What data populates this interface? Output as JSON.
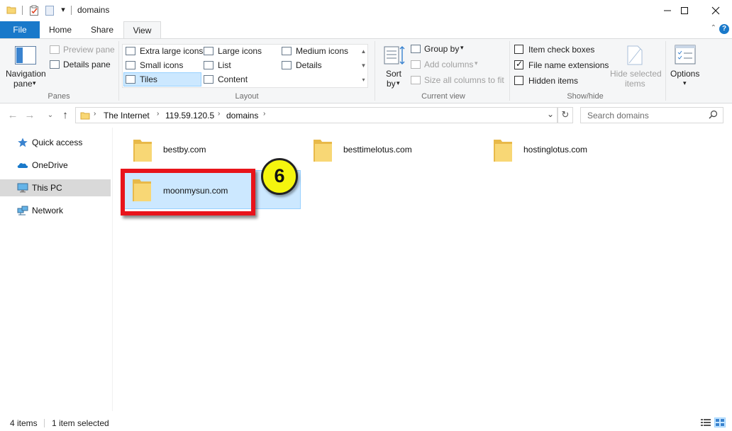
{
  "window": {
    "title": "domains",
    "minimize_glyph": "—",
    "maximize_glyph": "☐",
    "close_glyph": "✕"
  },
  "tabs": [
    {
      "label": "File",
      "active": false
    },
    {
      "label": "Home",
      "active": false
    },
    {
      "label": "Share",
      "active": false
    },
    {
      "label": "View",
      "active": true
    }
  ],
  "ribbon": {
    "panes": {
      "group_label": "Panes",
      "navigation_pane_line1": "Navigation",
      "navigation_pane_line2": "pane",
      "preview_pane": "Preview pane",
      "details_pane": "Details pane"
    },
    "layout": {
      "group_label": "Layout",
      "extra_large_icons": "Extra large icons",
      "large_icons": "Large icons",
      "medium_icons": "Medium icons",
      "small_icons": "Small icons",
      "list": "List",
      "details": "Details",
      "tiles": "Tiles",
      "content": "Content",
      "selected": "Tiles"
    },
    "current_view": {
      "group_label": "Current view",
      "sort_line1": "Sort",
      "sort_line2": "by",
      "group_by": "Group by",
      "add_columns": "Add columns",
      "size_all_columns": "Size all columns to fit"
    },
    "show_hide": {
      "group_label": "Show/hide",
      "item_check_boxes": "Item check boxes",
      "item_check_boxes_checked": false,
      "file_name_extensions": "File name extensions",
      "file_name_extensions_checked": true,
      "hidden_items": "Hidden items",
      "hidden_items_checked": false,
      "hide_selected_line1": "Hide selected",
      "hide_selected_line2": "items"
    },
    "options": {
      "label": "Options"
    }
  },
  "address": {
    "breadcrumbs": [
      "The Internet",
      "119.59.120.5",
      "domains"
    ],
    "search_placeholder": "Search domains"
  },
  "nav_pane": {
    "items": [
      {
        "label": "Quick access",
        "icon": "star-icon",
        "selected": false
      },
      {
        "label": "OneDrive",
        "icon": "cloud-icon",
        "selected": false
      },
      {
        "label": "This PC",
        "icon": "computer-icon",
        "selected": true
      },
      {
        "label": "Network",
        "icon": "network-icon",
        "selected": false
      }
    ]
  },
  "files": [
    {
      "name": "bestby.com",
      "selected": false
    },
    {
      "name": "besttimelotus.com",
      "selected": false
    },
    {
      "name": "hostinglotus.com",
      "selected": false
    },
    {
      "name": "moonmysun.com",
      "selected": true
    }
  ],
  "annotation": {
    "step_number": "6",
    "highlight_color": "#e8141b",
    "badge_color": "#f5f50e"
  },
  "status": {
    "item_count": "4 items",
    "selection": "1 item selected"
  },
  "colors": {
    "accent": "#1979ca",
    "selection_bg": "#cce8ff",
    "selection_border": "#99d1ff",
    "folder_yellow": "#f8d775"
  }
}
